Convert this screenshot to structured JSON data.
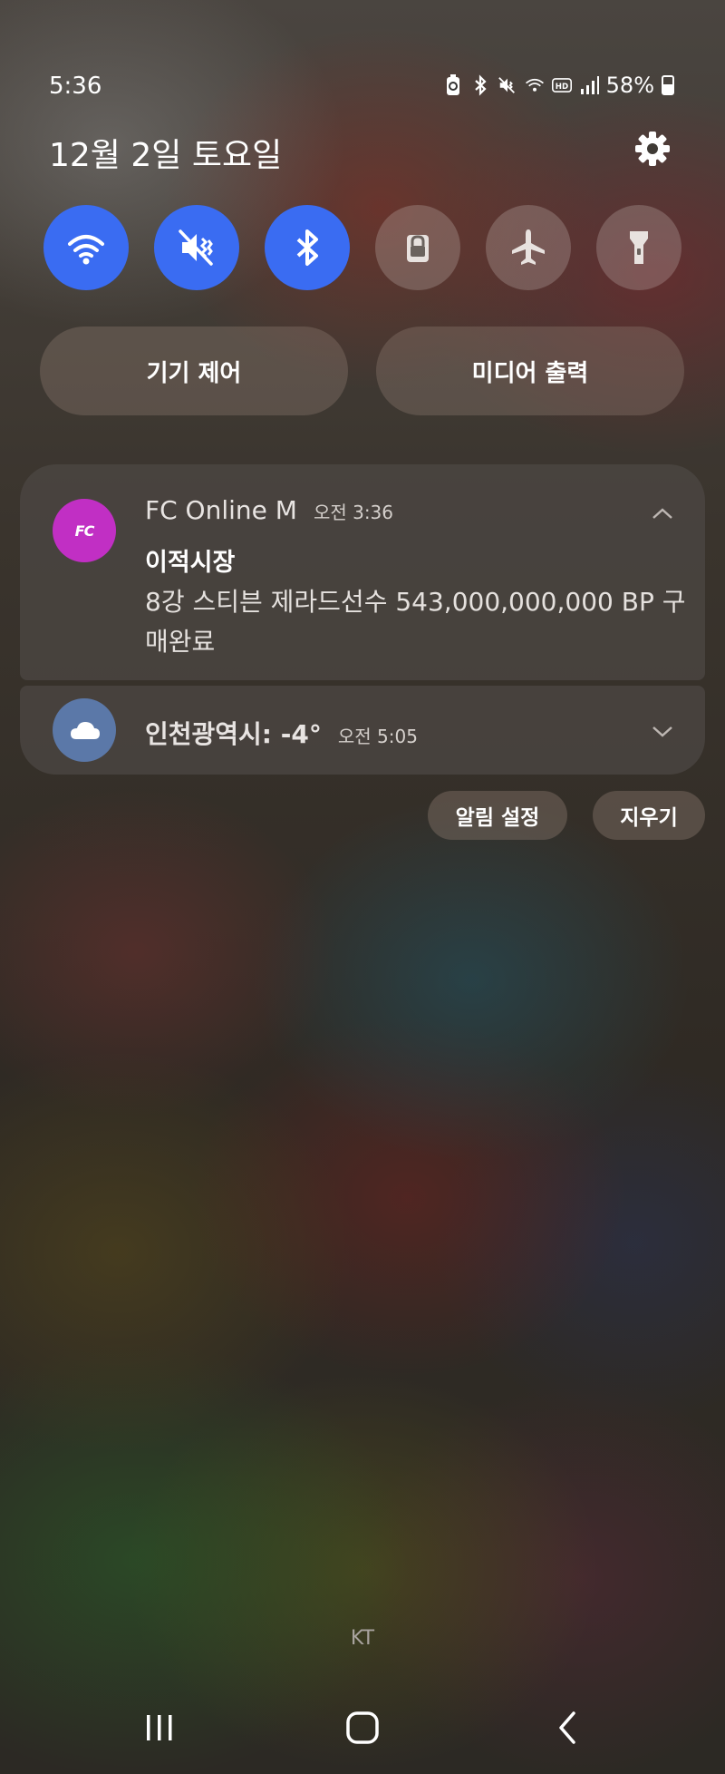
{
  "status_bar": {
    "time": "5:36",
    "battery_percent": "58%",
    "icons": [
      "battery-saver-icon",
      "bluetooth-icon",
      "vibrate-mute-icon",
      "wifi-icon",
      "hd-voice-icon",
      "signal-icon",
      "battery-icon"
    ]
  },
  "header": {
    "date": "12월 2일 토요일"
  },
  "quick_toggles": [
    {
      "name": "wifi",
      "icon": "wifi-icon",
      "state": "on"
    },
    {
      "name": "sound",
      "icon": "mute-icon",
      "state": "on"
    },
    {
      "name": "bluetooth",
      "icon": "bluetooth-icon",
      "state": "on"
    },
    {
      "name": "lock",
      "icon": "lock-icon",
      "state": "off"
    },
    {
      "name": "airplane",
      "icon": "airplane-icon",
      "state": "off"
    },
    {
      "name": "flashlight",
      "icon": "flashlight-icon",
      "state": "off"
    }
  ],
  "pills": {
    "device_control": "기기 제어",
    "media_output": "미디어 출력"
  },
  "notifications": [
    {
      "app_name": "FC Online M",
      "app_icon_text": "FC",
      "time": "오전 3:36",
      "title": "이적시장",
      "body": "8강 스티븐 제라드선수 543,000,000,000 BP 구매완료"
    },
    {
      "title": "인천광역시: -4°",
      "time": "오전 5:05",
      "icon": "cloud-icon"
    }
  ],
  "actions": {
    "notification_settings": "알림 설정",
    "clear": "지우기"
  },
  "carrier": "KT",
  "colors": {
    "toggle_on": "#3a6cf2",
    "fc_icon": "#c12fc4",
    "weather_icon": "#5b78a8"
  }
}
